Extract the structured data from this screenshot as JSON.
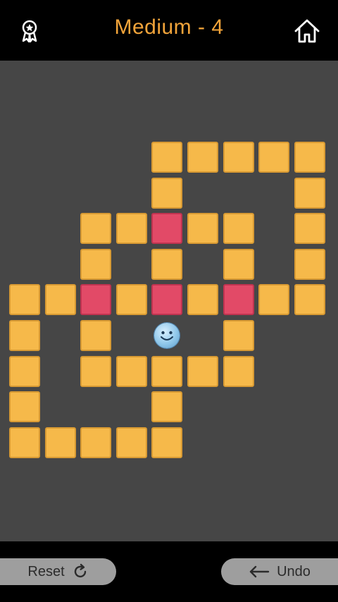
{
  "header": {
    "title": "Medium - 4",
    "left_icon": "award-ribbon-icon",
    "right_icon": "home-icon",
    "accent": "#f2a43a"
  },
  "board": {
    "background": "#464646",
    "tile_color": "#f6b94a",
    "target_color": "#e24a67",
    "tiles": [
      {
        "r": 0,
        "c": 4,
        "t": "plain"
      },
      {
        "r": 0,
        "c": 5,
        "t": "plain"
      },
      {
        "r": 0,
        "c": 6,
        "t": "plain"
      },
      {
        "r": 0,
        "c": 7,
        "t": "plain"
      },
      {
        "r": 0,
        "c": 8,
        "t": "plain"
      },
      {
        "r": 1,
        "c": 4,
        "t": "plain"
      },
      {
        "r": 1,
        "c": 8,
        "t": "plain"
      },
      {
        "r": 2,
        "c": 2,
        "t": "plain"
      },
      {
        "r": 2,
        "c": 3,
        "t": "plain"
      },
      {
        "r": 2,
        "c": 4,
        "t": "target"
      },
      {
        "r": 2,
        "c": 5,
        "t": "plain"
      },
      {
        "r": 2,
        "c": 6,
        "t": "plain"
      },
      {
        "r": 2,
        "c": 8,
        "t": "plain"
      },
      {
        "r": 3,
        "c": 2,
        "t": "plain"
      },
      {
        "r": 3,
        "c": 4,
        "t": "plain"
      },
      {
        "r": 3,
        "c": 6,
        "t": "plain"
      },
      {
        "r": 3,
        "c": 8,
        "t": "plain"
      },
      {
        "r": 4,
        "c": 0,
        "t": "plain"
      },
      {
        "r": 4,
        "c": 1,
        "t": "plain"
      },
      {
        "r": 4,
        "c": 2,
        "t": "target"
      },
      {
        "r": 4,
        "c": 3,
        "t": "plain"
      },
      {
        "r": 4,
        "c": 4,
        "t": "target"
      },
      {
        "r": 4,
        "c": 5,
        "t": "plain"
      },
      {
        "r": 4,
        "c": 6,
        "t": "target"
      },
      {
        "r": 4,
        "c": 7,
        "t": "plain"
      },
      {
        "r": 4,
        "c": 8,
        "t": "plain"
      },
      {
        "r": 5,
        "c": 0,
        "t": "plain"
      },
      {
        "r": 5,
        "c": 2,
        "t": "plain"
      },
      {
        "r": 5,
        "c": 6,
        "t": "plain"
      },
      {
        "r": 6,
        "c": 0,
        "t": "plain"
      },
      {
        "r": 6,
        "c": 2,
        "t": "plain"
      },
      {
        "r": 6,
        "c": 3,
        "t": "plain"
      },
      {
        "r": 6,
        "c": 4,
        "t": "plain"
      },
      {
        "r": 6,
        "c": 5,
        "t": "plain"
      },
      {
        "r": 6,
        "c": 6,
        "t": "plain"
      },
      {
        "r": 7,
        "c": 0,
        "t": "plain"
      },
      {
        "r": 7,
        "c": 4,
        "t": "plain"
      },
      {
        "r": 8,
        "c": 0,
        "t": "plain"
      },
      {
        "r": 8,
        "c": 1,
        "t": "plain"
      },
      {
        "r": 8,
        "c": 2,
        "t": "plain"
      },
      {
        "r": 8,
        "c": 3,
        "t": "plain"
      },
      {
        "r": 8,
        "c": 4,
        "t": "plain"
      }
    ],
    "player": {
      "r": 5,
      "c": 4,
      "icon": "smiley-face-icon"
    }
  },
  "footer": {
    "reset_label": "Reset",
    "reset_icon": "refresh-icon",
    "undo_label": "Undo",
    "undo_icon": "arrow-left-icon"
  }
}
